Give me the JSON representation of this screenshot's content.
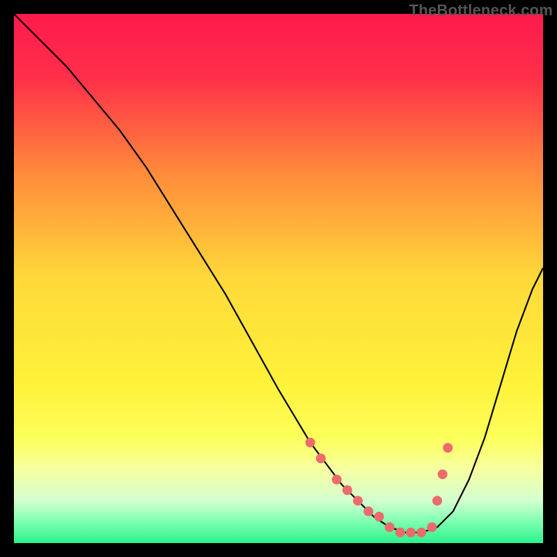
{
  "watermark": "TheBottleneck.com",
  "chart_data": {
    "type": "line",
    "title": "",
    "xlabel": "",
    "ylabel": "",
    "xlim": [
      0,
      100
    ],
    "ylim": [
      0,
      100
    ],
    "grid": false,
    "legend": false,
    "gradient_stops": [
      {
        "pos": 0.0,
        "color": "#ff1a4d"
      },
      {
        "pos": 0.12,
        "color": "#ff2f4a"
      },
      {
        "pos": 0.3,
        "color": "#ff8a3a"
      },
      {
        "pos": 0.5,
        "color": "#ffd93a"
      },
      {
        "pos": 0.7,
        "color": "#fff23a"
      },
      {
        "pos": 0.8,
        "color": "#fdff5a"
      },
      {
        "pos": 0.86,
        "color": "#f7ffa0"
      },
      {
        "pos": 0.92,
        "color": "#d4ffd0"
      },
      {
        "pos": 0.96,
        "color": "#7dffb0"
      },
      {
        "pos": 1.0,
        "color": "#2bf28c"
      }
    ],
    "series": [
      {
        "name": "bottleneck-curve",
        "color": "#000000",
        "x": [
          0,
          5,
          10,
          15,
          20,
          25,
          30,
          35,
          40,
          45,
          50,
          53,
          56,
          59,
          62,
          65,
          68,
          71,
          74,
          77,
          80,
          83,
          86,
          89,
          92,
          95,
          98,
          100
        ],
        "y": [
          100,
          95,
          90,
          84,
          78,
          71,
          63,
          55,
          47,
          38,
          29,
          24,
          19,
          15,
          11,
          8,
          5,
          3,
          2,
          2,
          3,
          6,
          12,
          20,
          30,
          40,
          48,
          52
        ]
      }
    ],
    "markers": {
      "name": "threshold-markers",
      "color": "#ec6b6b",
      "radius": 7,
      "x": [
        56,
        58,
        61,
        63,
        65,
        67,
        69,
        71,
        73,
        75,
        77,
        79,
        80,
        81,
        82
      ],
      "y": [
        19,
        16,
        12,
        10,
        8,
        6,
        5,
        3,
        2,
        2,
        2,
        3,
        8,
        13,
        18
      ]
    }
  }
}
